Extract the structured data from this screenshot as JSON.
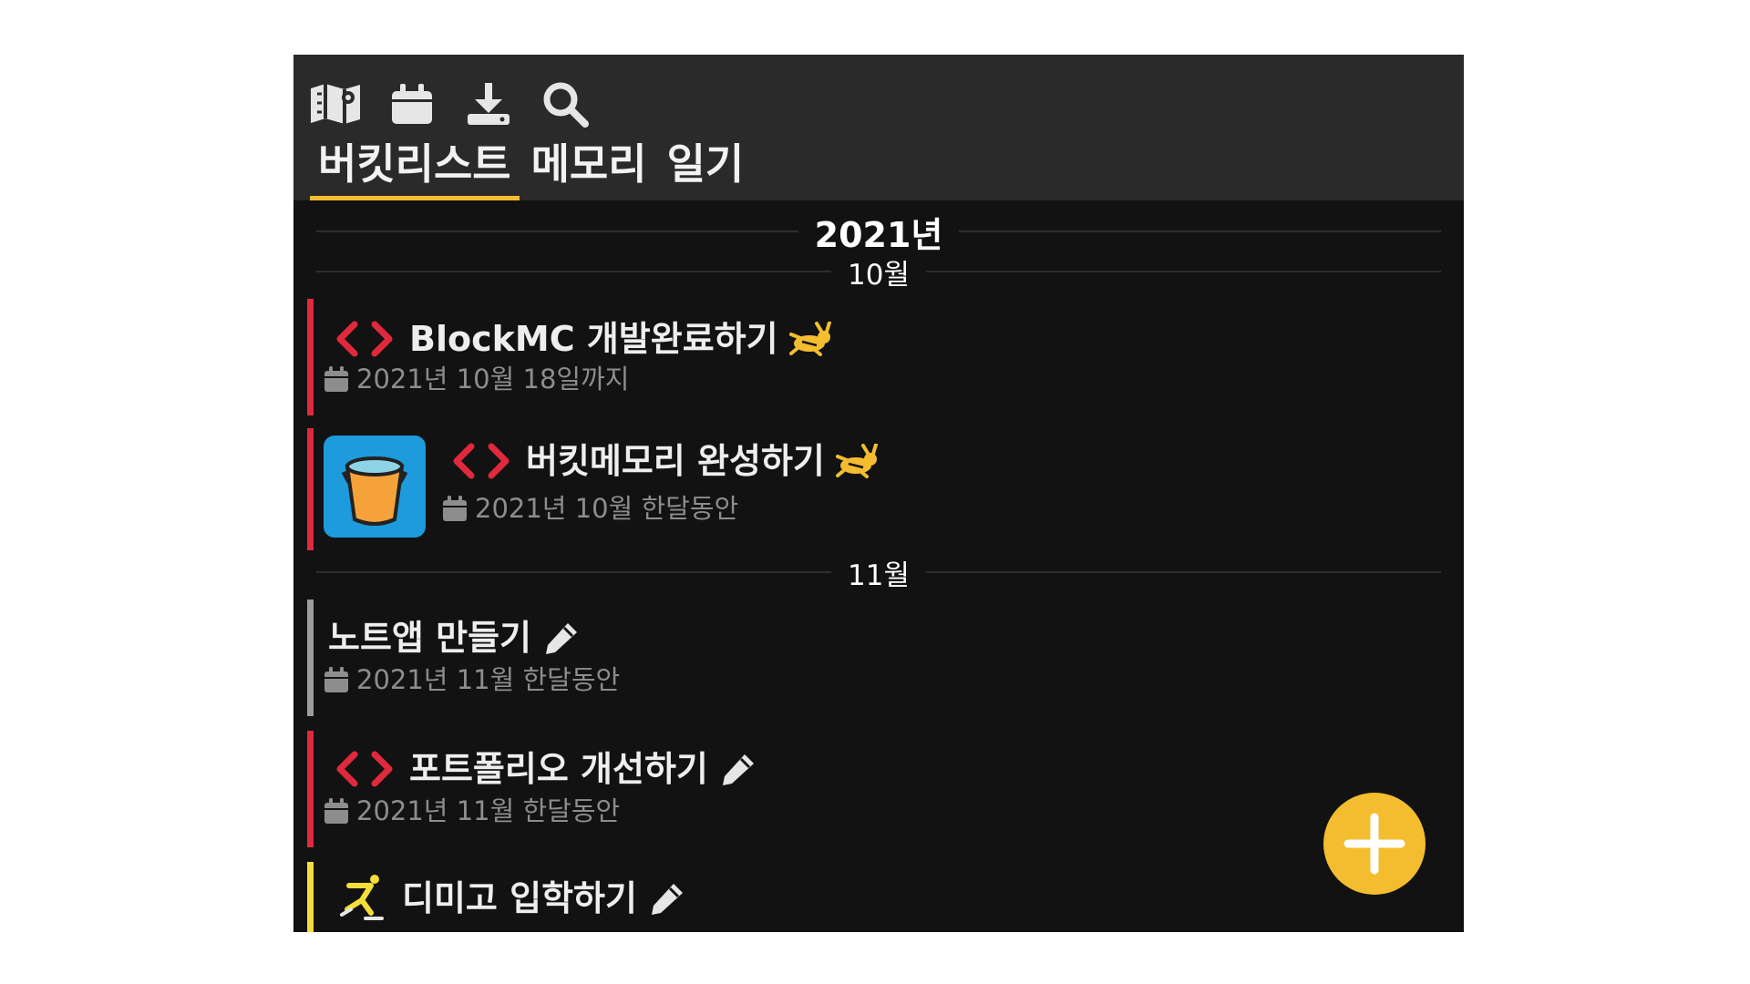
{
  "toolbar": {
    "icons": [
      "map-icon",
      "calendar-icon",
      "download-icon",
      "search-icon"
    ]
  },
  "tabs": [
    {
      "label": "버킷리스트",
      "active": true
    },
    {
      "label": "메모리",
      "active": false
    },
    {
      "label": "일기",
      "active": false
    }
  ],
  "timeline": {
    "year": "2021년",
    "months": [
      "10월",
      "11월"
    ]
  },
  "items": [
    {
      "title": "BlockMC 개발완료하기",
      "date": "2021년 10월 18일까지",
      "category_icon": "code-icon",
      "status_icon": "rabbit-icon",
      "bar_color": "#e0293c"
    },
    {
      "title": "버킷메모리 완성하기",
      "date": "2021년 10월 한달동안",
      "category_icon": "code-icon",
      "status_icon": "rabbit-icon",
      "bar_color": "#e0293c",
      "thumbnail": "bucket-icon"
    },
    {
      "title": "노트앱 만들기",
      "date": "2021년 11월 한달동안",
      "category_icon": "",
      "status_icon": "pen-icon",
      "bar_color": "#9c9c9c"
    },
    {
      "title": "포트폴리오 개선하기",
      "date": "2021년 11월 한달동안",
      "category_icon": "code-icon",
      "status_icon": "pen-icon",
      "bar_color": "#e0293c"
    },
    {
      "title": "디미고 입학하기",
      "date": "",
      "category_icon": "skater-icon",
      "status_icon": "pen-icon",
      "bar_color": "#f3dd3a"
    }
  ],
  "colors": {
    "accent": "#f3bd2f",
    "code_red": "#e0293c",
    "background": "#121212",
    "header": "#2a2a2a"
  }
}
